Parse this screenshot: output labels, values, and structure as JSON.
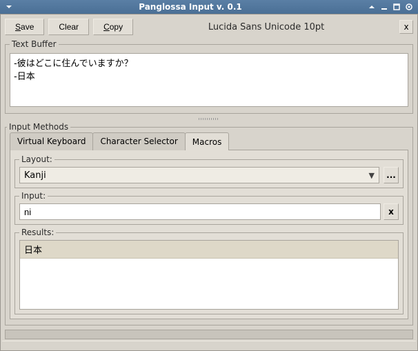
{
  "window": {
    "title": "Panglossa Input v. 0.1"
  },
  "toolbar": {
    "save": "Save",
    "clear": "Clear",
    "copy": "Copy",
    "font_label": "Lucida Sans Unicode 10pt",
    "close": "x"
  },
  "text_buffer": {
    "legend": "Text Buffer",
    "content": "-彼はどこに住んでいますか？\n-日本"
  },
  "input_methods": {
    "legend": "Input Methods",
    "tabs": [
      {
        "label": "Virtual Keyboard",
        "active": false
      },
      {
        "label": "Character Selector",
        "active": false
      },
      {
        "label": "Macros",
        "active": true
      }
    ],
    "layout": {
      "label": "Layout:",
      "value": "Kanji",
      "more": "..."
    },
    "input": {
      "label": "Input:",
      "value": "ni",
      "clear": "x"
    },
    "results": {
      "label": "Results:",
      "items": [
        "日本"
      ]
    }
  }
}
